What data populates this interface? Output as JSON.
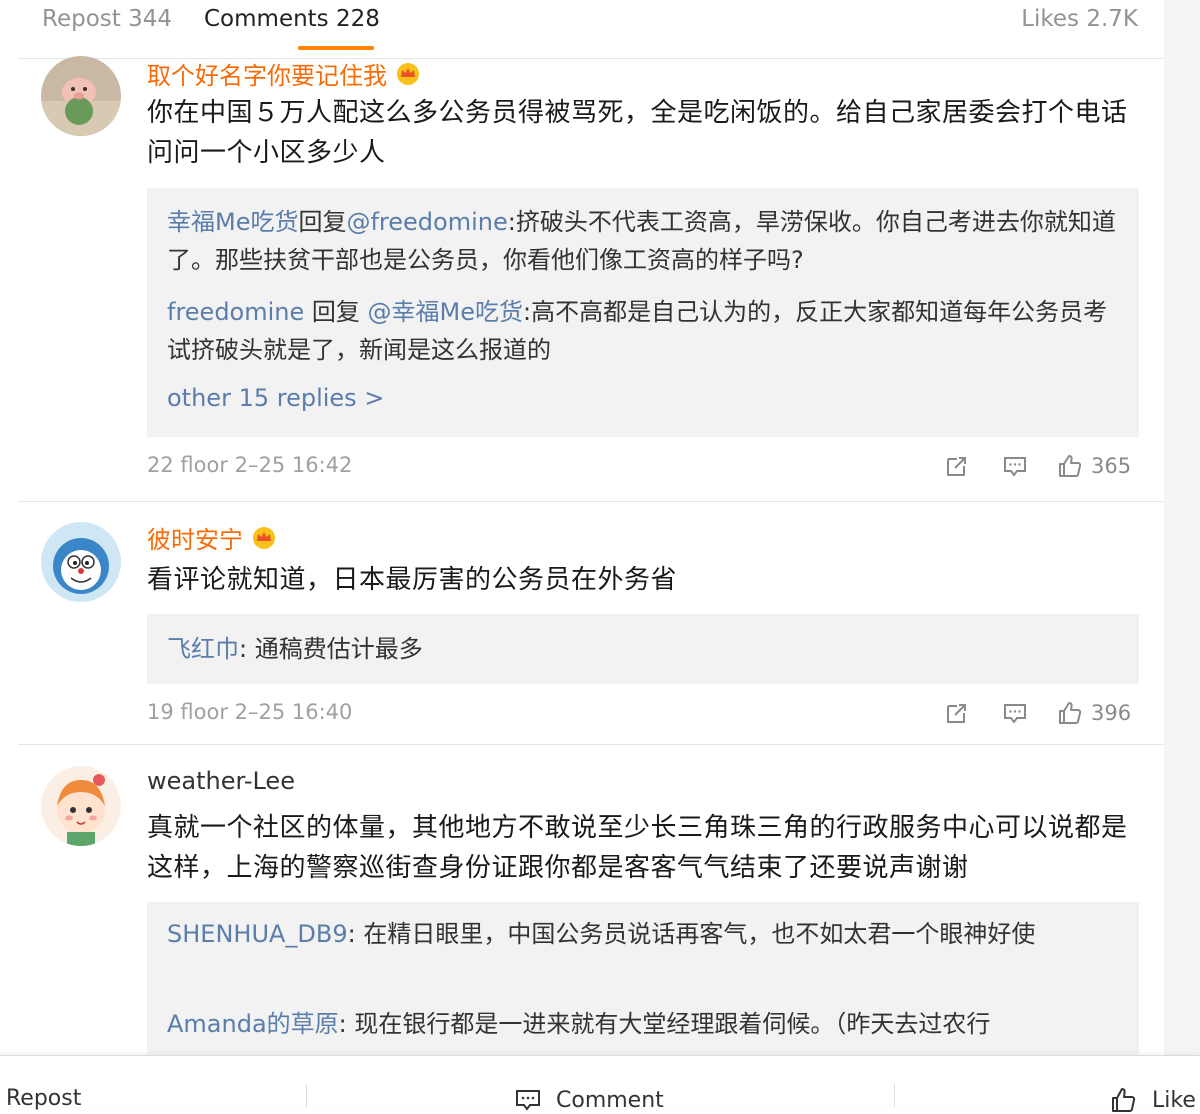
{
  "tabs": {
    "repost": "Repost 344",
    "comments": "Comments 228",
    "likes": "Likes 2.7K",
    "accent_color": "#ff8200"
  },
  "comments": [
    {
      "author": "取个好名字你要记住我",
      "text": "你在中国５万人配这么多公务员得被骂死，全是吃闲饭的。给自己家居委会打个电话问问一个小区多少人",
      "replies": [
        {
          "user": "幸福Me吃货",
          "verb": "回复",
          "mention": "@freedomine",
          "text": ":挤破头不代表工资高，旱涝保收。你自己考进去你就知道了。那些扶贫干部也是公务员，你看他们像工资高的样子吗?"
        },
        {
          "user": "freedomine",
          "verb": " 回复 ",
          "mention": "@幸福Me吃货",
          "text": ":高不高都是自己认为的，反正大家都知道每年公务员考试挤破头就是了，新闻是这么报道的"
        }
      ],
      "more": "other 15 replies >",
      "meta": "22 floor 2–25 16:42",
      "likes": "365"
    },
    {
      "author": "彼时安宁",
      "text": "看评论就知道，日本最厉害的公务员在外务省",
      "replies": [
        {
          "user": "飞红巾",
          "text": ": 通稿费估计最多"
        }
      ],
      "meta": "19 floor 2–25 16:40",
      "likes": "396"
    },
    {
      "author": "weather-Lee",
      "text": "真就一个社区的体量，其他地方不敢说至少长三角珠三角的行政服务中心可以说都是这样，上海的警察巡街查身份证跟你都是客客气气结束了还要说声谢谢",
      "replies": [
        {
          "user": "SHENHUA_DB9",
          "text": ": 在精日眼里，中国公务员说话再客气，也不如太君一个眼神好使"
        },
        {
          "user": "Amanda的草原",
          "text": ": 现在银行都是一进来就有大堂经理跟着伺候。（昨天去过农行"
        }
      ]
    }
  ],
  "bottom_bar": {
    "repost": "Repost",
    "comment": "Comment",
    "like": "Like"
  },
  "colors": {
    "vip_name": "#f86b07",
    "link_blue": "#5b7dab"
  }
}
